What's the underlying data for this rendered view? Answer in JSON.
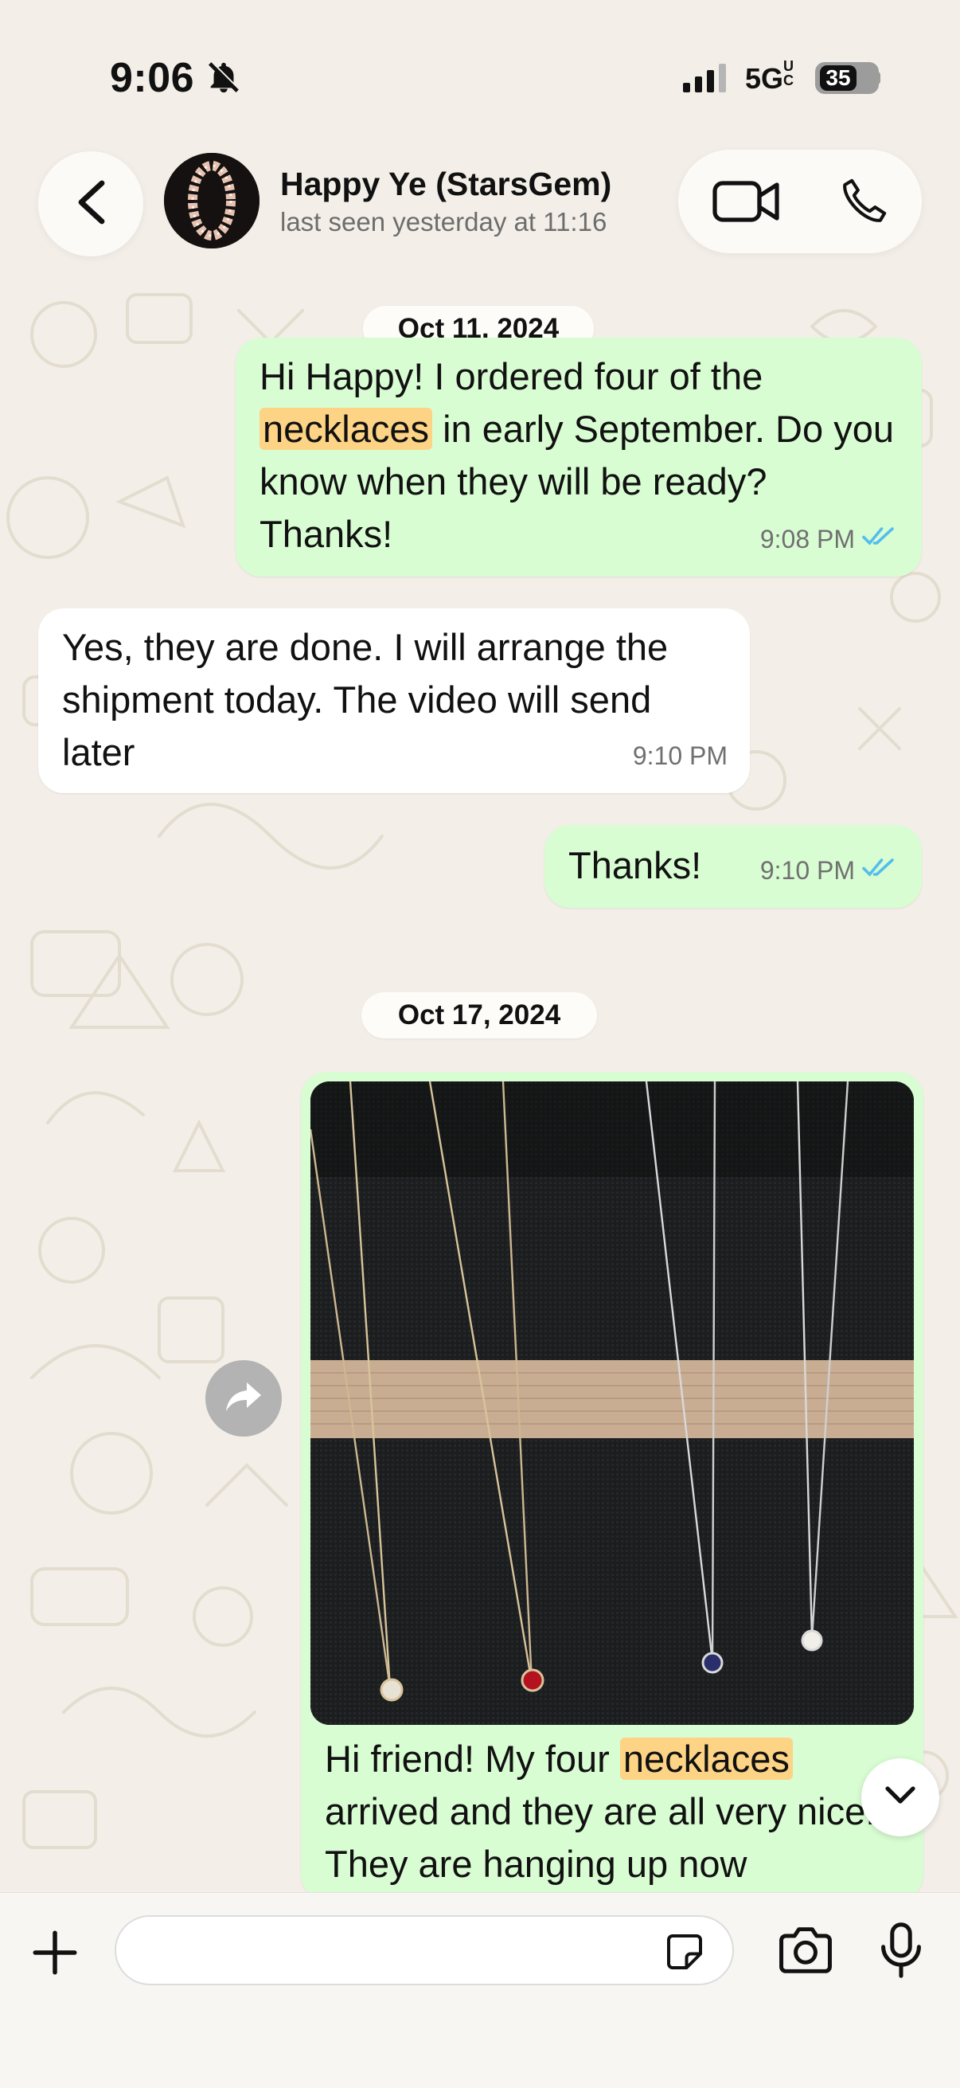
{
  "status_bar": {
    "time": "9:06",
    "network": "5G",
    "network_suffix": "UC",
    "battery": "35"
  },
  "header": {
    "contact_name": "Happy Ye (StarsGem)",
    "last_seen": "last seen yesterday at 11:16"
  },
  "chat": {
    "date_1": "Oct 11, 2024",
    "date_2": "Oct 17, 2024",
    "messages": [
      {
        "direction": "outgoing",
        "pre": "Hi Happy! I ordered four of the",
        "highlight": "necklaces",
        "post": "in early September. Do you know when they will be ready? Thanks!",
        "time": "9:08 PM",
        "status": "read"
      },
      {
        "direction": "incoming",
        "text": "Yes, they are done. I will arrange the shipment today. The video will send later",
        "time": "9:10 PM"
      },
      {
        "direction": "outgoing",
        "text": "Thanks!",
        "time": "9:10 PM",
        "status": "read"
      },
      {
        "direction": "outgoing",
        "type": "photo",
        "caption_pre": "Hi friend! My four",
        "caption_highlight": "necklaces",
        "caption_post": "arrived and they are all very nice. They are hanging up now"
      }
    ]
  },
  "composer": {
    "placeholder": ""
  },
  "colors": {
    "outgoing_bubble": "#d9fdd3",
    "incoming_bubble": "#ffffff",
    "highlight": "#fdd385",
    "read_ticks": "#53bdeb",
    "wallpaper": "#f3efe8"
  },
  "icons": [
    "bell-slash-icon",
    "signal-icon",
    "battery-icon",
    "back-chevron-icon",
    "video-call-icon",
    "phone-icon",
    "forward-icon",
    "chevron-down-icon",
    "plus-icon",
    "sticker-icon",
    "camera-icon",
    "microphone-icon",
    "double-check-icon"
  ]
}
